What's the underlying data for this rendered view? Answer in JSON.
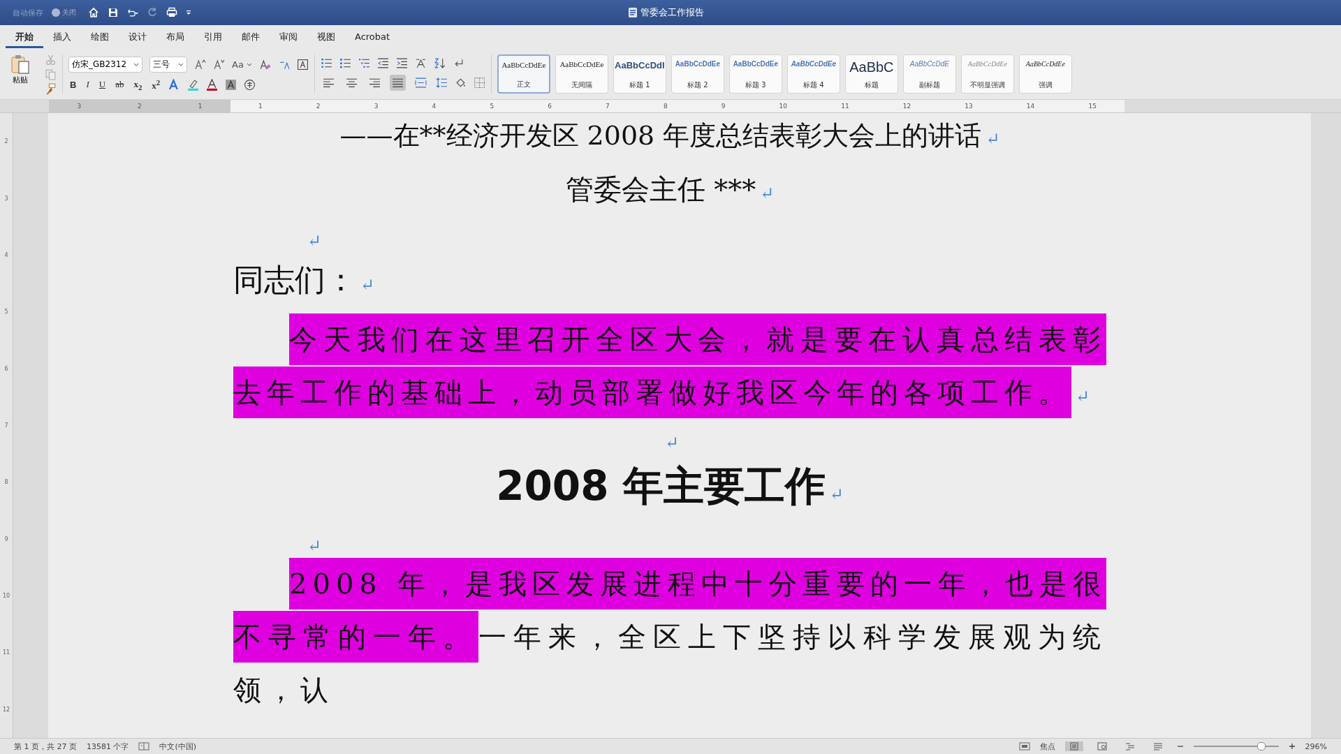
{
  "title_bar": {
    "autosave_label": "自动保存",
    "autosave_toggle": {
      "on": false,
      "label": "关闭"
    },
    "document_title": "管委会工作报告"
  },
  "tabs": [
    {
      "label": "开始",
      "selected": true
    },
    {
      "label": "插入",
      "selected": false
    },
    {
      "label": "绘图",
      "selected": false
    },
    {
      "label": "设计",
      "selected": false
    },
    {
      "label": "布局",
      "selected": false
    },
    {
      "label": "引用",
      "selected": false
    },
    {
      "label": "邮件",
      "selected": false
    },
    {
      "label": "审阅",
      "selected": false
    },
    {
      "label": "视图",
      "selected": false
    },
    {
      "label": "Acrobat",
      "selected": false
    }
  ],
  "ribbon": {
    "paste_label": "粘贴",
    "font_name": "仿宋_GB2312",
    "font_size": "三号",
    "change_case": "Aa",
    "format_buttons": [
      {
        "text": "B",
        "kind": "bold"
      },
      {
        "text": "I",
        "kind": "italic"
      },
      {
        "text": "U",
        "kind": "underline"
      },
      {
        "text": "ab",
        "kind": "strike"
      },
      {
        "text": "x$_{2}$",
        "kind": "script"
      },
      {
        "text": "x$^{2}$",
        "kind": "script"
      }
    ],
    "alignments": [
      {
        "kind": "left",
        "selected": false
      },
      {
        "kind": "center",
        "selected": false
      },
      {
        "kind": "right",
        "selected": false
      },
      {
        "kind": "justify",
        "selected": true
      },
      {
        "kind": "distributed",
        "selected": false
      }
    ],
    "styles": [
      {
        "preview": "AaBbCcDdEe",
        "name": "正文",
        "kind": "normal",
        "selected": true
      },
      {
        "preview": "AaBbCcDdEe",
        "name": "无间隔",
        "kind": "normal",
        "selected": false
      },
      {
        "preview": "AaBbCcDdI",
        "name": "标题 1",
        "kind": "heading1",
        "selected": false
      },
      {
        "preview": "AaBbCcDdEe",
        "name": "标题 2",
        "kind": "heading2",
        "selected": false
      },
      {
        "preview": "AaBbCcDdEe",
        "name": "标题 3",
        "kind": "heading3",
        "selected": false
      },
      {
        "preview": "AaBbCcDdEe",
        "name": "标题 4",
        "kind": "heading4",
        "selected": false
      },
      {
        "preview": "AaBbC",
        "name": "标题",
        "kind": "title",
        "selected": false
      },
      {
        "preview": "AaBbCcDdE",
        "name": "副标题",
        "kind": "subtitle",
        "selected": false
      },
      {
        "preview": "AaBbCcDdEe",
        "name": "不明显强调",
        "kind": "subtle",
        "selected": false
      },
      {
        "preview": "AaBbCcDdEe",
        "name": "强调",
        "kind": "emphasis",
        "selected": false
      }
    ]
  },
  "ruler": {
    "left_labels": [
      "3",
      "2",
      "1"
    ],
    "right_labels": [
      "1",
      "2",
      "3",
      "4",
      "5",
      "6",
      "7",
      "8",
      "9",
      "10",
      "11",
      "12",
      "13",
      "14",
      "15"
    ],
    "vertical_labels": [
      "2",
      "3",
      "4",
      "5",
      "6",
      "7",
      "8",
      "9",
      "10",
      "11",
      "12"
    ]
  },
  "document": {
    "blocks": [
      {
        "kind": "center",
        "text": "——在**经济开发区 2008 年度总结表彰大会上的讲话",
        "mark": "↵"
      },
      {
        "kind": "center",
        "text": "管委会主任 ***",
        "mark": "↵"
      },
      {
        "kind": "empty",
        "mark": "↵"
      },
      {
        "kind": "greeting",
        "text": "同志们：",
        "mark": "↵"
      },
      {
        "kind": "paragraph",
        "segments": [
          {
            "text": "今天我们在这里召开全区大会，就是要在认真总结表彰去年工作的基础上，动员部署做好我区今年的各项工作。",
            "highlighted": true
          }
        ],
        "mark": "↵"
      },
      {
        "kind": "empty_center",
        "mark": "↵"
      },
      {
        "kind": "heading",
        "text": "2008 年主要工作",
        "mark": "↵"
      },
      {
        "kind": "empty",
        "mark": "↵"
      },
      {
        "kind": "paragraph",
        "segments": [
          {
            "text": "2008 年，是我区发展进程中十分重要的一年，也是很不寻常的一年。",
            "highlighted": true
          },
          {
            "text": "一年来，全区上下坚持以科学发展观为统领，认",
            "highlighted": false
          }
        ]
      }
    ]
  },
  "status_bar": {
    "page": "第 1 页，共 27 页",
    "word_count": "13581 个字",
    "language": "中文(中国)",
    "focus": "焦点",
    "view_buttons": [
      {
        "kind": "print",
        "selected": true
      },
      {
        "kind": "web",
        "selected": false
      },
      {
        "kind": "outline",
        "selected": false
      },
      {
        "kind": "draft",
        "selected": false
      }
    ],
    "zoom": {
      "level": 0.8
    },
    "zoom_value": "296%"
  }
}
